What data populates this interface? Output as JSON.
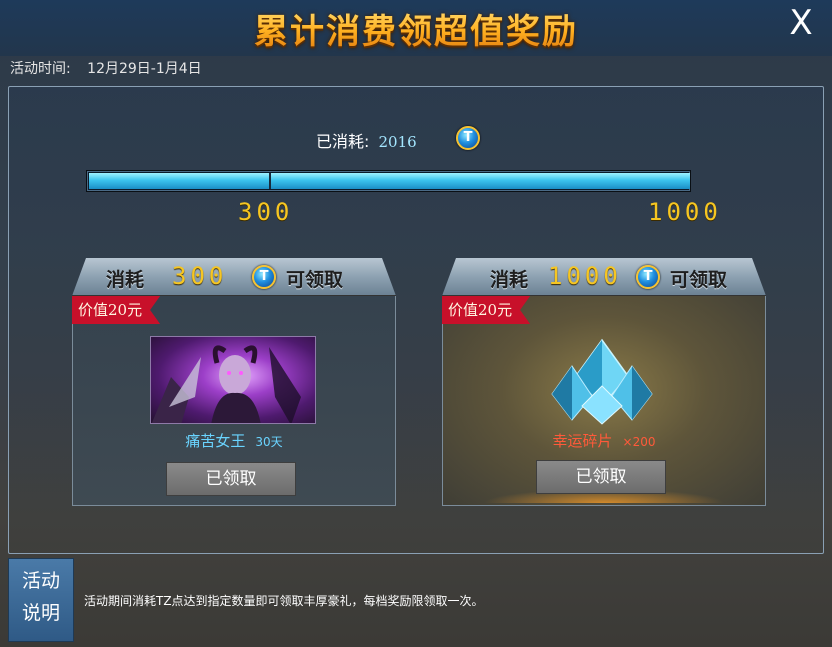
{
  "header": {
    "title": "累计消费领超值奖励",
    "close_label": "X"
  },
  "activity": {
    "time_label": "活动时间:",
    "time_value": "12月29日-1月4日"
  },
  "progress": {
    "consumed_label": "已消耗:",
    "consumed_value": "2016",
    "currency_icon": "tz-coin-icon",
    "currency_glyph": "T",
    "fill_fraction": 1.0,
    "marks": [
      300,
      1000
    ],
    "tick_left": "300",
    "tick_right": "1000"
  },
  "rewards": [
    {
      "cost_label": "消耗",
      "cost_value": "300",
      "claimable_label": "可领取",
      "ribbon": "价值20元",
      "item_icon": "portrait-icon",
      "item_name": "痛苦女王",
      "item_sub": "30天",
      "button": "已领取"
    },
    {
      "cost_label": "消耗",
      "cost_value": "1000",
      "claimable_label": "可领取",
      "ribbon": "价值20元",
      "item_icon": "crystal-shard-icon",
      "item_name": "幸运碎片",
      "item_sub": "×200",
      "button": "已领取"
    }
  ],
  "footer": {
    "desc_button_line1": "活动",
    "desc_button_line2": "说明",
    "desc_text": "活动期间消耗TZ点达到指定数量即可领取丰厚豪礼，每档奖励限领取一次。"
  },
  "colors": {
    "accent_gold": "#f6c622",
    "bar_blue": "#3cc4ee",
    "ribbon_red": "#c8102a"
  }
}
